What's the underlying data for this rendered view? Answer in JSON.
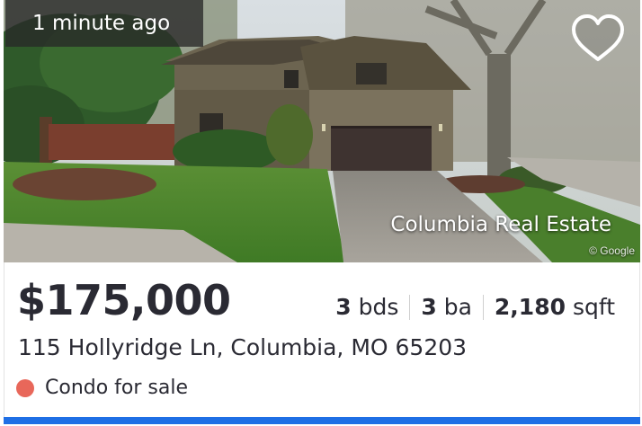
{
  "listing": {
    "time_ago": "1 minute ago",
    "brand": "Columbia Real Estate",
    "photo_credit": "© Google",
    "price": "$175,000",
    "beds_value": "3",
    "beds_unit": "bds",
    "baths_value": "3",
    "baths_unit": "ba",
    "sqft_value": "2,180",
    "sqft_unit": "sqft",
    "address": "115 Hollyridge Ln, Columbia, MO 65203",
    "status": "Condo for sale"
  },
  "icons": {
    "favorite": "heart-outline-icon",
    "status": "status-dot-icon"
  },
  "colors": {
    "status_dot": "#e8675a",
    "bottom_bar": "#1f6fe5",
    "text": "#2a2a33"
  }
}
